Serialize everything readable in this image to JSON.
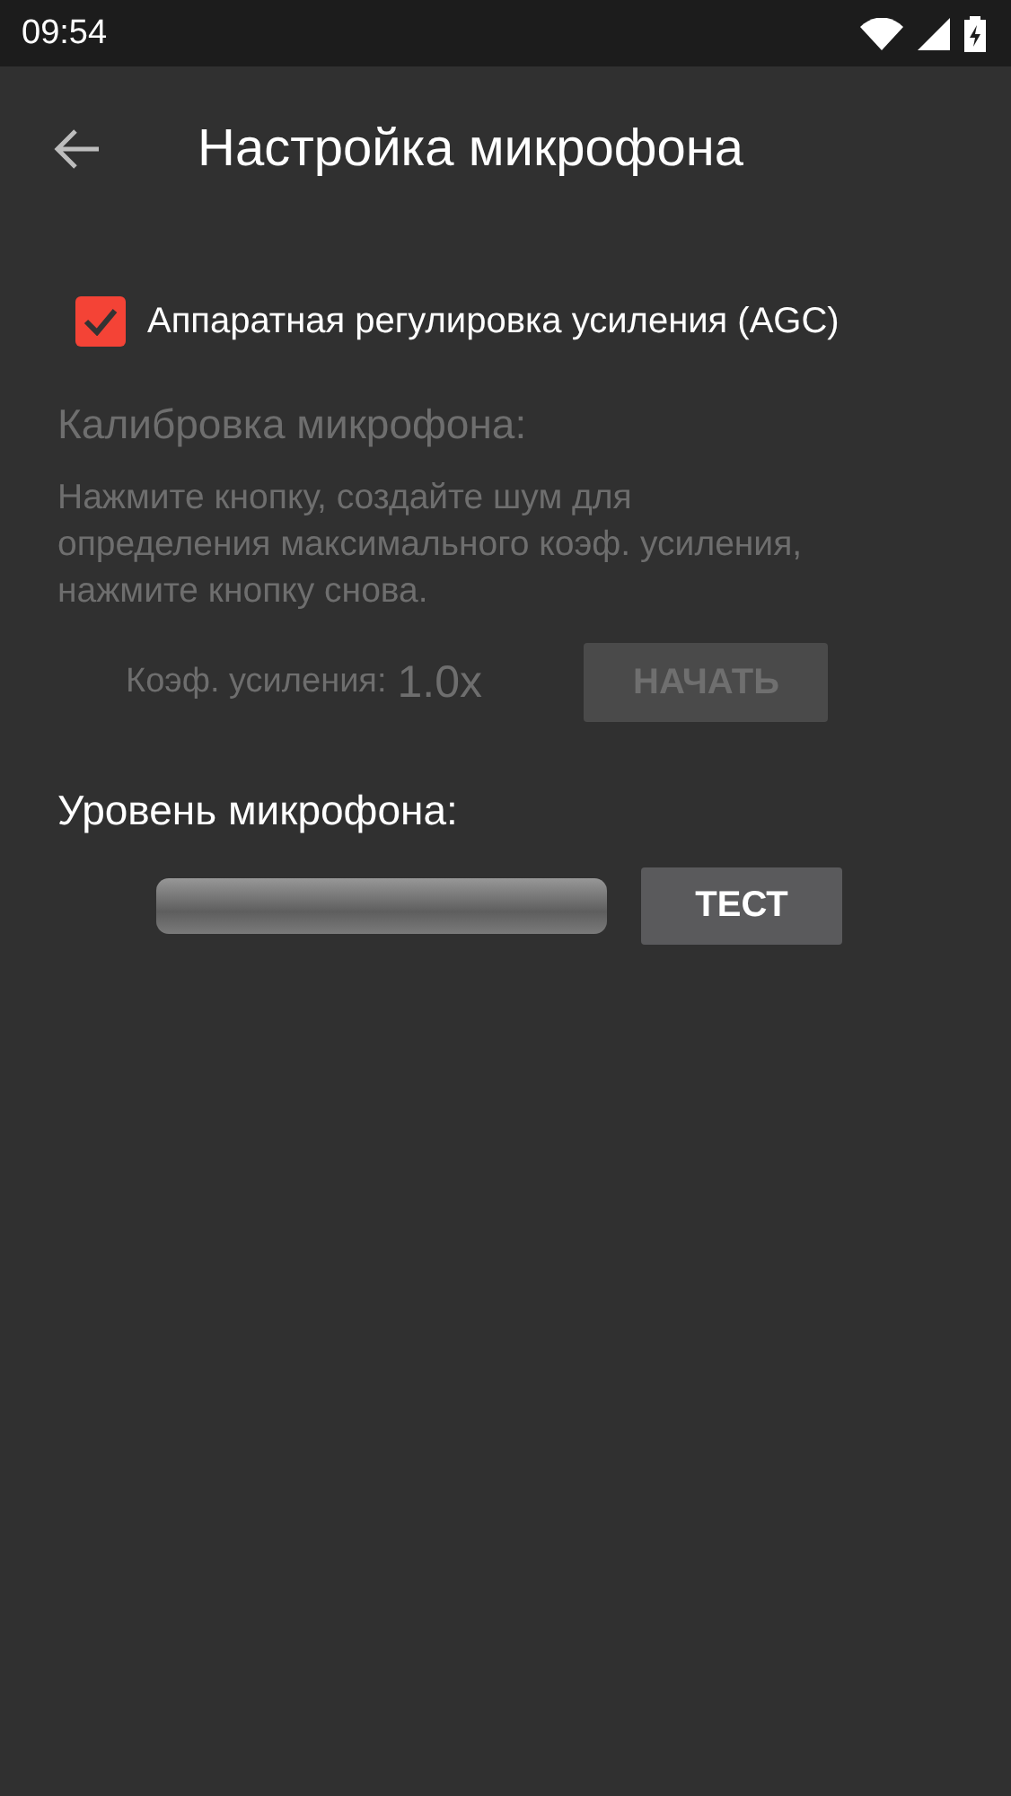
{
  "status_bar": {
    "time": "09:54"
  },
  "app_bar": {
    "title": "Настройка микрофона"
  },
  "agc": {
    "label": "Аппаратная регулировка усиления (AGC)",
    "checked": true
  },
  "calibration": {
    "disabled": true,
    "title": "Калибровка микрофона:",
    "description": "Нажмите кнопку, создайте шум для определения максимального коэф. усиления, нажмите кнопку снова.",
    "gain_label": "Коэф. усиления:",
    "gain_value": "1.0x",
    "button": "НАЧАТЬ"
  },
  "mic_level": {
    "title": "Уровень микрофона:",
    "button": "ТЕСТ"
  }
}
